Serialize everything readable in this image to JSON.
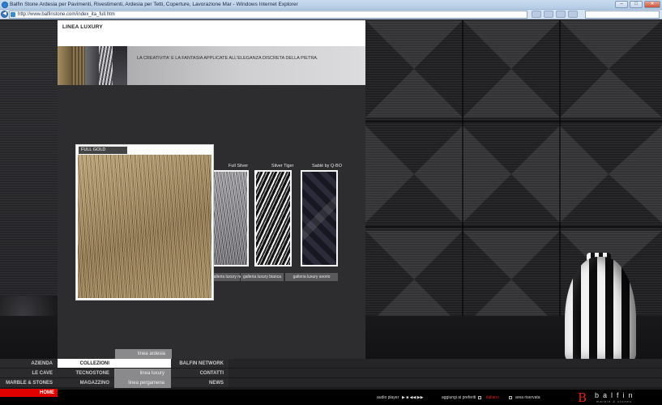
{
  "browser": {
    "title": "Balfin Stone Ardesia per Pavimenti, Rivestimenti, Ardesia per Tetti, Coperture, Lavorazione Mar - Windows Internet Explorer",
    "url": "http://www.balfinstone.com/index_ita_full.htm"
  },
  "page": {
    "section_title": "LINEA LUXURY",
    "tagline": "LA CREATIVITA' E LA FANTASIA APPLICATE ALL'ELEGANZA DISCRETA DELLA PIETRA."
  },
  "tiles": [
    {
      "label": "Full Silver",
      "texture": "silver"
    },
    {
      "label": "Silver Tiger",
      "texture": "tiger"
    },
    {
      "label": "Sablé by Q-BO",
      "texture": "sable"
    }
  ],
  "gallery_buttons": [
    "galleria luxury nera",
    "galleria luxury bianca",
    "galleria luxury avorio"
  ],
  "feature": {
    "title": "FULL GOLD",
    "texture": "gold"
  },
  "submenu": [
    "linea ardesia",
    "linea luxury",
    "linea pergamena"
  ],
  "nav": {
    "col1": [
      "AZIENDA",
      "LE CAVE",
      "MARBLE & STONES"
    ],
    "col2": [
      "COLLEZIONI",
      "TECNOSTONE",
      "MAGAZZINO"
    ],
    "col3": [
      "BALFIN NETWORK",
      "CONTATTI",
      "NEWS"
    ],
    "home": "HOME",
    "active": "COLLEZIONI"
  },
  "footer": {
    "audio_player": "audio player",
    "favorites": "aggiungi ai preferiti",
    "red_link": "italiano",
    "reserved_area": "area riservata",
    "logo": "balfin",
    "logo_sub": "marble & stones"
  }
}
